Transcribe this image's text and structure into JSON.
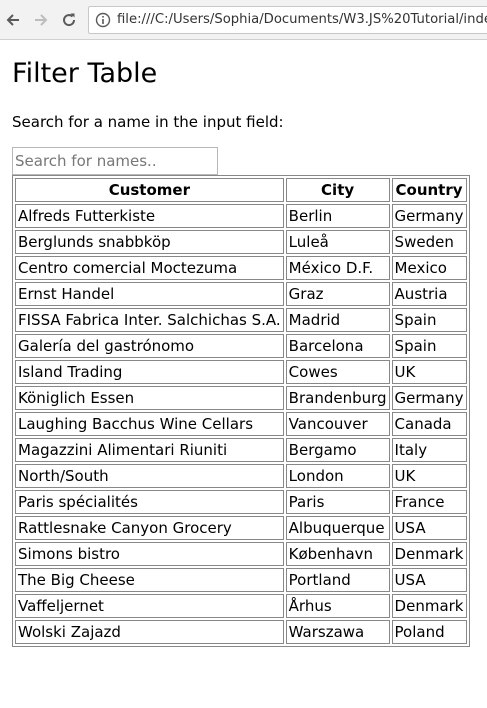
{
  "browser": {
    "url": "file:///C:/Users/Sophia/Documents/W3.JS%20Tutorial/index.html"
  },
  "page": {
    "title": "Filter Table",
    "description": "Search for a name in the input field:",
    "search": {
      "placeholder": "Search for names..",
      "value": ""
    }
  },
  "table": {
    "headers": [
      "Customer",
      "City",
      "Country"
    ],
    "rows": [
      [
        "Alfreds Futterkiste",
        "Berlin",
        "Germany"
      ],
      [
        "Berglunds snabbköp",
        "Luleå",
        "Sweden"
      ],
      [
        "Centro comercial Moctezuma",
        "México D.F.",
        "Mexico"
      ],
      [
        "Ernst Handel",
        "Graz",
        "Austria"
      ],
      [
        "FISSA Fabrica Inter. Salchichas S.A.",
        "Madrid",
        "Spain"
      ],
      [
        "Galería del gastrónomo",
        "Barcelona",
        "Spain"
      ],
      [
        "Island Trading",
        "Cowes",
        "UK"
      ],
      [
        "Königlich Essen",
        "Brandenburg",
        "Germany"
      ],
      [
        "Laughing Bacchus Wine Cellars",
        "Vancouver",
        "Canada"
      ],
      [
        "Magazzini Alimentari Riuniti",
        "Bergamo",
        "Italy"
      ],
      [
        "North/South",
        "London",
        "UK"
      ],
      [
        "Paris spécialités",
        "Paris",
        "France"
      ],
      [
        "Rattlesnake Canyon Grocery",
        "Albuquerque",
        "USA"
      ],
      [
        "Simons bistro",
        "København",
        "Denmark"
      ],
      [
        "The Big Cheese",
        "Portland",
        "USA"
      ],
      [
        "Vaffeljernet",
        "Århus",
        "Denmark"
      ],
      [
        "Wolski Zajazd",
        "Warszawa",
        "Poland"
      ]
    ]
  }
}
